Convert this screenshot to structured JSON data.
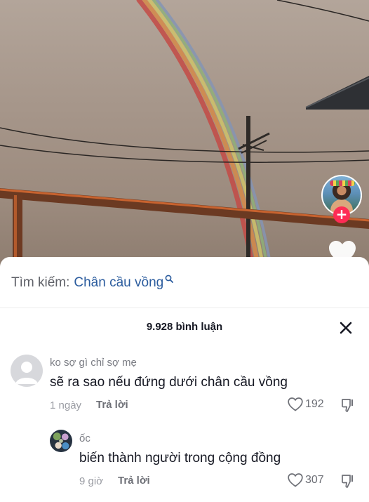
{
  "search": {
    "prefix": "Tìm kiếm:",
    "query": "Chân cầu vồng"
  },
  "comments_header": {
    "count_label": "9.928 bình luận"
  },
  "comments": [
    {
      "user": "ko sợ gì chỉ sợ mẹ",
      "text": "sẽ ra sao nếu đứng dưới chân cầu vồng",
      "time": "1 ngày",
      "reply_label": "Trả lời",
      "likes": "192"
    },
    {
      "user": "ốc",
      "text": "biến thành người trong cộng đồng",
      "time": "9 giờ",
      "reply_label": "Trả lời",
      "likes": "307"
    }
  ],
  "colors": {
    "follow_accent": "#fe2c55",
    "search_query": "#2b5c9e"
  }
}
